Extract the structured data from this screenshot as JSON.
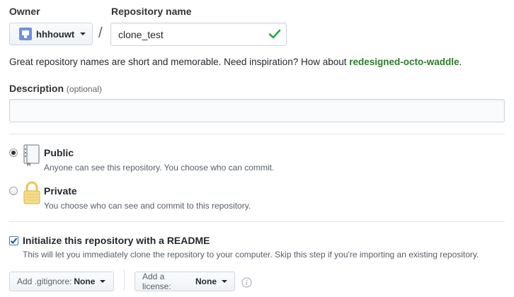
{
  "owner": {
    "label": "Owner",
    "value": "hhhouwt"
  },
  "repo": {
    "label": "Repository name",
    "value": "clone_test",
    "separator": "/"
  },
  "hint": {
    "text": "Great repository names are short and memorable. Need inspiration? How about ",
    "suggestion": "redesigned-octo-waddle",
    "end": "."
  },
  "description": {
    "label": "Description",
    "optional": "(optional)",
    "value": ""
  },
  "visibility": {
    "public": {
      "title": "Public",
      "note": "Anyone can see this repository. You choose who can commit.",
      "selected": true
    },
    "private": {
      "title": "Private",
      "note": "You choose who can see and commit to this repository.",
      "selected": false
    }
  },
  "readme": {
    "label": "Initialize this repository with a README",
    "note": "This will let you immediately clone the repository to your computer. Skip this step if you're importing an existing repository.",
    "checked": true
  },
  "gitignore": {
    "prefix": "Add .gitignore:",
    "value": "None"
  },
  "license": {
    "prefix": "Add a license:",
    "value": "None"
  },
  "colors": {
    "suggestion": "#2c7a2c",
    "check": "#28a745",
    "lock": "#e8c65a"
  },
  "icons": [
    "avatar",
    "check-icon",
    "repo-book-icon",
    "lock-icon",
    "info-icon",
    "caret-down-icon"
  ]
}
